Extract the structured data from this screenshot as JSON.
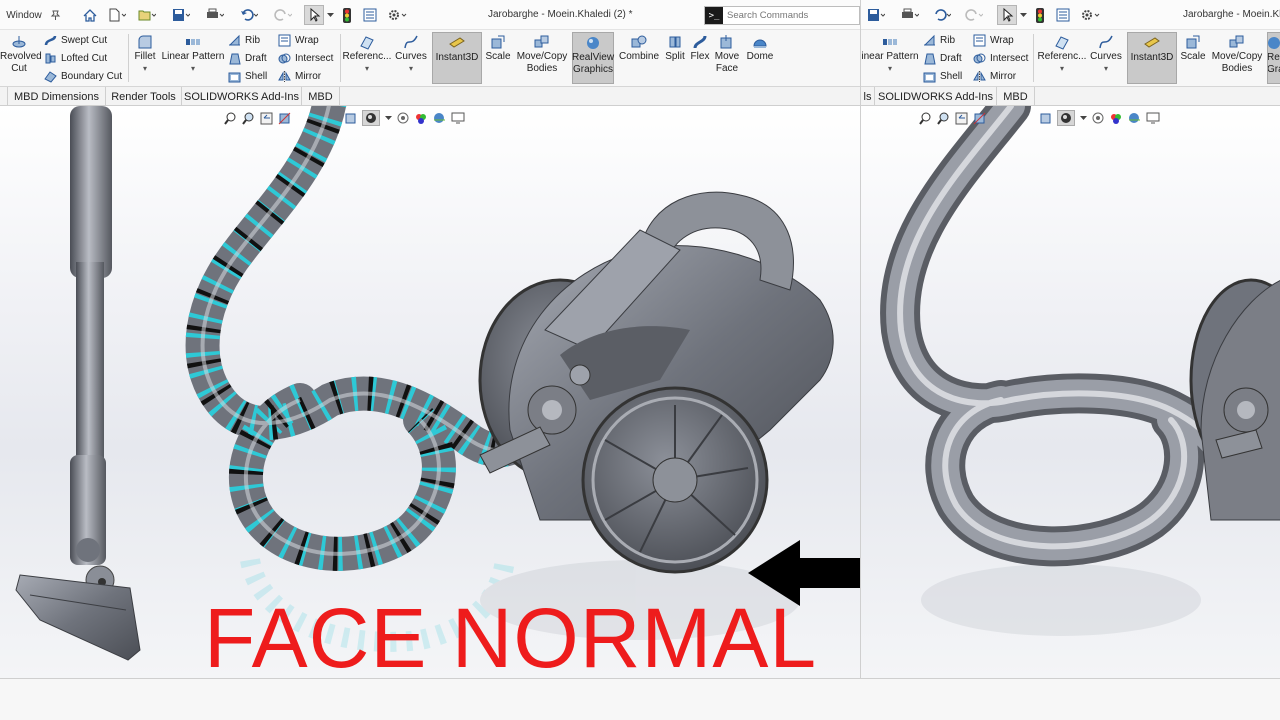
{
  "left": {
    "menu_window": "Window",
    "title": "Jarobarghe - Moein.Khaledi (2) *",
    "search_placeholder": "Search Commands",
    "ribbon": {
      "revolved_cut": "Revolved Cut",
      "swept_cut": "Swept Cut",
      "lofted_cut": "Lofted Cut",
      "boundary_cut": "Boundary Cut",
      "fillet": "Fillet",
      "linear_pattern": "Linear Pattern",
      "rib": "Rib",
      "draft": "Draft",
      "shell": "Shell",
      "wrap": "Wrap",
      "intersect": "Intersect",
      "mirror": "Mirror",
      "reference": "Referenc...",
      "curves": "Curves",
      "instant3d": "Instant3D",
      "scale": "Scale",
      "move_copy_bodies": "Move/Copy Bodies",
      "realview_graphics": "RealView Graphics",
      "combine": "Combine",
      "split": "Split",
      "flex": "Flex",
      "move_face": "Move Face",
      "dome": "Dome"
    },
    "tabs": [
      "MBD Dimensions",
      "Render Tools",
      "SOLIDWORKS Add-Ins",
      "MBD"
    ]
  },
  "right": {
    "title": "Jarobarghe - Moein.Kh",
    "ribbon": {
      "linear_pattern": "inear Pattern",
      "rib": "Rib",
      "draft": "Draft",
      "shell": "Shell",
      "wrap": "Wrap",
      "intersect": "Intersect",
      "mirror": "Mirror",
      "reference": "Referenc...",
      "curves": "Curves",
      "instant3d": "Instant3D",
      "scale": "Scale",
      "move_copy_bodies": "Move/Copy Bodies",
      "realview_cut": "Rea Gra"
    },
    "tabs": [
      "ls",
      "SOLIDWORKS Add-Ins",
      "MBD"
    ]
  },
  "overlay": {
    "label": "FACE NORMAL"
  },
  "colors": {
    "overlay_text": "#ee1c1c",
    "hose_highlight": "#2ec9d6",
    "model_gray": "#7b7e86",
    "arrow": "#000000"
  }
}
